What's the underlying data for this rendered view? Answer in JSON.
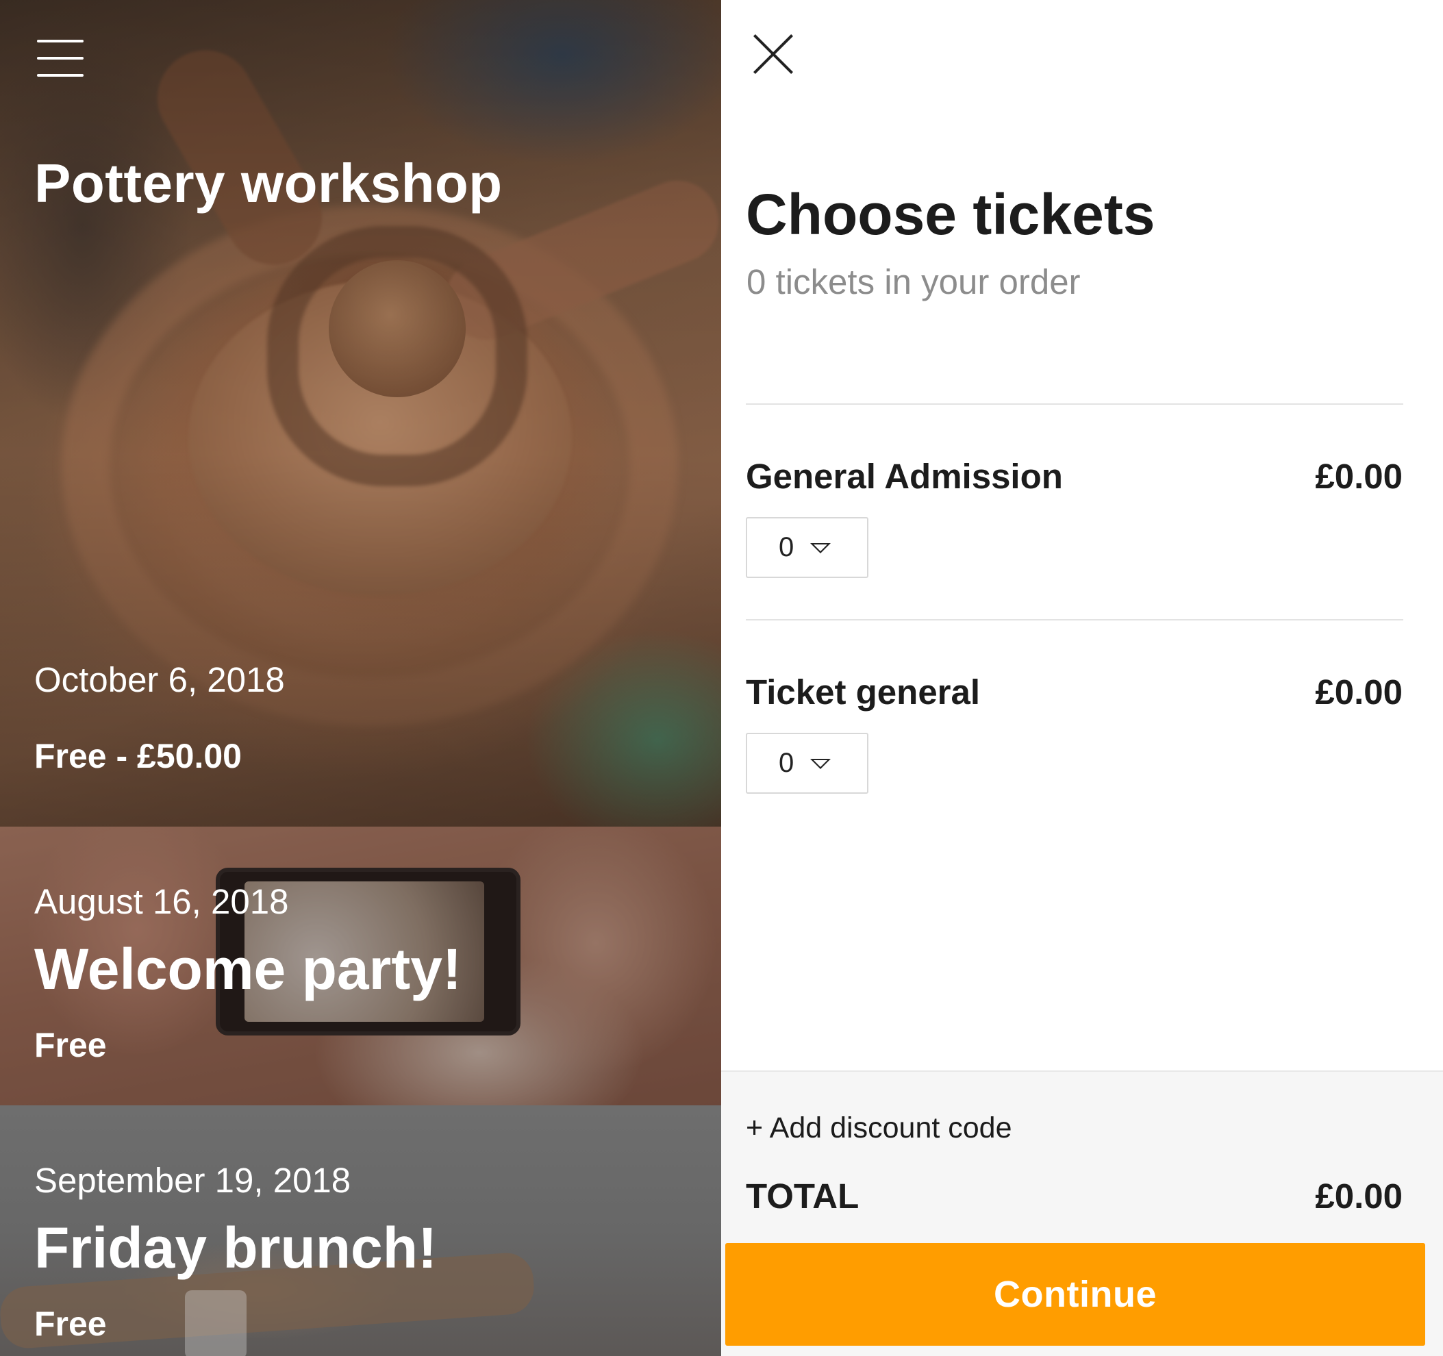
{
  "left": {
    "featured": {
      "title": "Pottery workshop",
      "date": "October 6, 2018",
      "price": "Free - £50.00"
    },
    "events": [
      {
        "date": "August 16, 2018",
        "name": "Welcome party!",
        "price": "Free"
      },
      {
        "date": "September 19, 2018",
        "name": "Friday brunch!",
        "price": "Free"
      }
    ]
  },
  "panel": {
    "title": "Choose tickets",
    "subtitle": "0 tickets in your order",
    "tickets": [
      {
        "name": "General Admission",
        "price": "£0.00",
        "quantity": "0"
      },
      {
        "name": "Ticket general",
        "price": "£0.00",
        "quantity": "0"
      }
    ],
    "discount_label": "+ Add discount code",
    "total_label": "TOTAL",
    "total_value": "£0.00",
    "continue_label": "Continue",
    "accent_color": "#ff9d00"
  },
  "icons": {
    "menu": "menu-icon",
    "close": "close-icon",
    "dropdown": "chevron-down-icon"
  }
}
